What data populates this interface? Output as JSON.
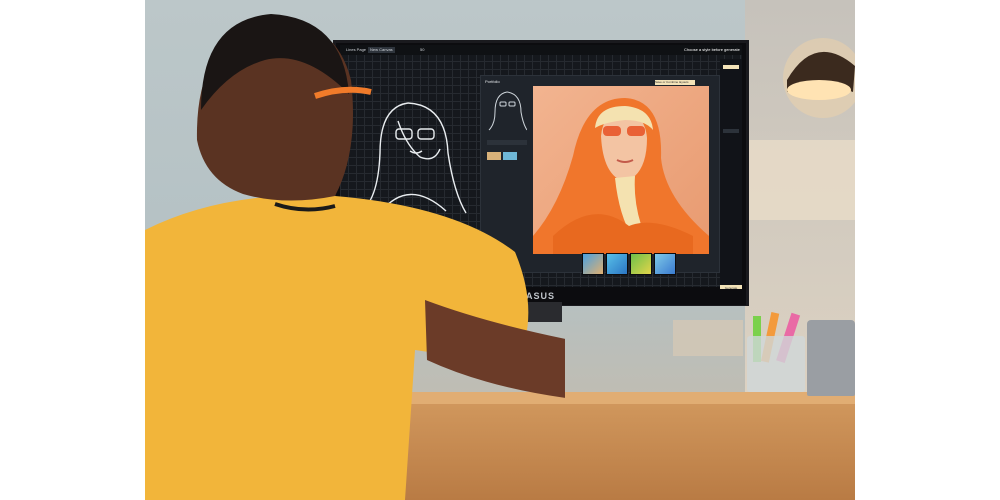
{
  "monitor": {
    "brand": "ASUS",
    "toolbar": {
      "tabs": [
        "Lines Page",
        "New Canvas"
      ],
      "zoom": "50"
    },
    "screen": {
      "panel_title": "Portfolio",
      "right_panel_heading": "Choose a style before generate",
      "buttons": {
        "save": "Save or Combine layouts",
        "generate": "Generate"
      }
    }
  },
  "scene": {
    "colors": {
      "shirt": "#f2b53a",
      "hoodie": "#f0762c",
      "backdrop": "#f2b490",
      "desk": "#d39a5f",
      "lamp_glow": "#ffd9a0"
    }
  }
}
